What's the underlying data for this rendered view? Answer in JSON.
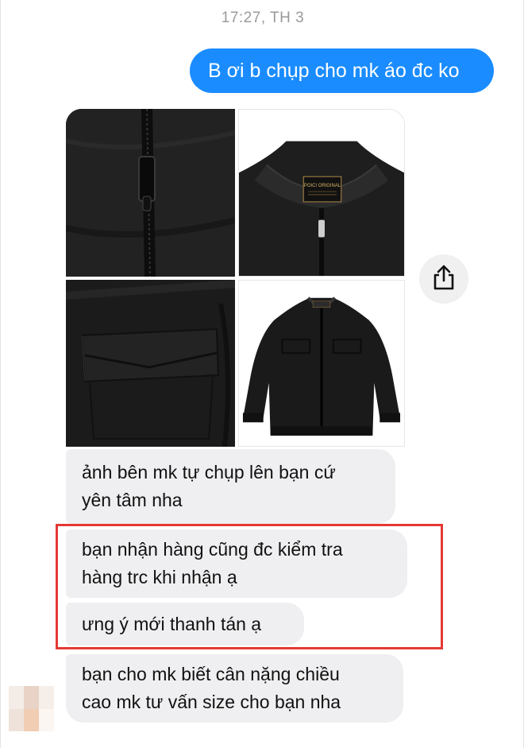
{
  "header": {
    "timestamp": "17:27, TH 3"
  },
  "messages": {
    "outgoing_1": "B ơi b chụp cho mk áo đc ko",
    "incoming_1_line1": "ảnh bên mk tự chụp lên bạn cứ",
    "incoming_1_line2": "yên tâm nha",
    "incoming_2_line1": "bạn nhận hàng cũng đc kiểm tra",
    "incoming_2_line2": "hàng trc khi nhận ạ",
    "incoming_3": "ưng ý mới thanh tán ạ",
    "incoming_4_line1": "bạn cho mk biết cân nặng chiều",
    "incoming_4_line2": "cao mk tư vấn size cho bạn nha"
  },
  "photos": {
    "label_text": "POICI ORIGINAL",
    "items": [
      "jacket-zipper-closeup",
      "jacket-collar-label",
      "jacket-pocket-closeup",
      "jacket-full-view"
    ]
  },
  "icons": {
    "share": "share-icon"
  },
  "colors": {
    "outgoing_bubble": "#1a8cff",
    "incoming_bubble": "#efeff1",
    "highlight_border": "#e53935",
    "timestamp_text": "#9a9a9a"
  }
}
